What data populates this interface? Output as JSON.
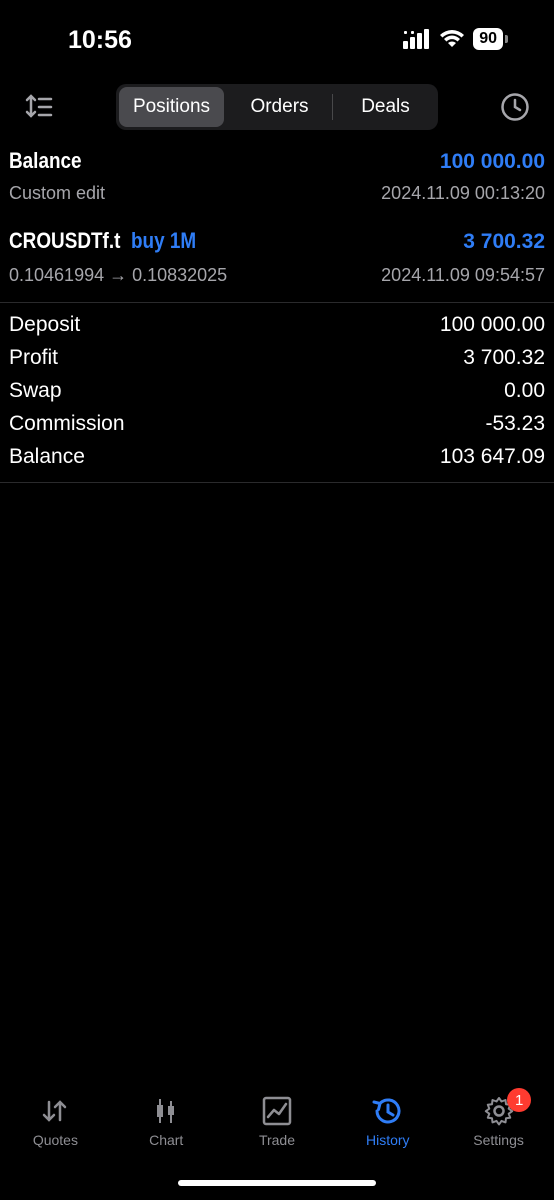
{
  "status_bar": {
    "time": "10:56",
    "battery": "90",
    "icons": [
      "signal-icon",
      "wifi-icon",
      "battery-icon"
    ]
  },
  "toolbar": {
    "tabs": [
      {
        "label": "Positions",
        "active": true
      },
      {
        "label": "Orders",
        "active": false
      },
      {
        "label": "Deals",
        "active": false
      }
    ],
    "sort_icon": "sort-icon",
    "history_clock_icon": "clock-icon"
  },
  "balance_entry": {
    "title": "Balance",
    "amount": "100 000.00",
    "comment": "Custom edit",
    "datetime": "2024.11.09 00:13:20"
  },
  "deal_entry": {
    "symbol": "CROUSDTf.t",
    "side": "buy 1M",
    "profit": "3 700.32",
    "prices": "0.10461994 → 0.10832025",
    "datetime": "2024.11.09 09:54:57"
  },
  "summary": [
    {
      "label": "Deposit",
      "value": "100 000.00"
    },
    {
      "label": "Profit",
      "value": "3 700.32"
    },
    {
      "label": "Swap",
      "value": "0.00"
    },
    {
      "label": "Commission",
      "value": "-53.23"
    },
    {
      "label": "Balance",
      "value": "103 647.09"
    }
  ],
  "tabbar": {
    "tabs": [
      {
        "label": "Quotes",
        "icon": "quotes-arrows-icon"
      },
      {
        "label": "Chart",
        "icon": "candlestick-chart-icon"
      },
      {
        "label": "Trade",
        "icon": "trade-chart-icon"
      },
      {
        "label": "History",
        "icon": "history-icon",
        "active": true
      },
      {
        "label": "Settings",
        "icon": "gear-icon",
        "badge": "1"
      }
    ]
  },
  "colors": {
    "accent_blue": "#2f7df6",
    "background": "#000000",
    "badge_red": "#ff3b30"
  }
}
